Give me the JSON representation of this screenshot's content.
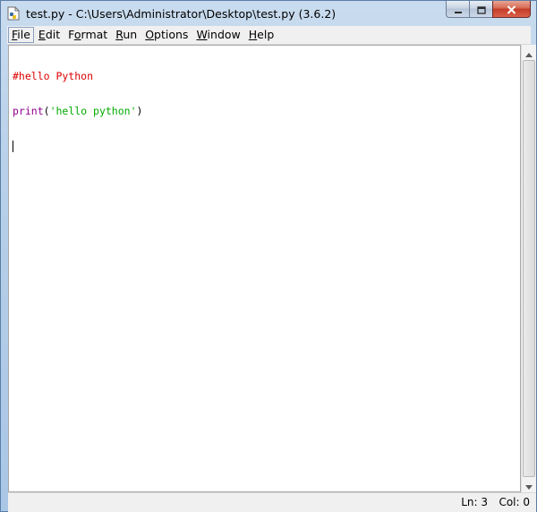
{
  "window": {
    "title": "test.py - C:\\Users\\Administrator\\Desktop\\test.py (3.6.2)",
    "icon": "python-file-icon"
  },
  "caption_buttons": {
    "minimize_icon": "minimize-icon",
    "maximize_icon": "maximize-icon",
    "close_icon": "close-icon"
  },
  "menu": {
    "items": [
      {
        "label_rest": "ile",
        "mnemonic": "F"
      },
      {
        "label_rest": "dit",
        "mnemonic": "E"
      },
      {
        "label_pre": "F",
        "mnemonic": "o",
        "label_rest": "rmat"
      },
      {
        "label_rest": "un",
        "mnemonic": "R"
      },
      {
        "label_rest": "ptions",
        "mnemonic": "O"
      },
      {
        "label_rest": "indow",
        "mnemonic": "W"
      },
      {
        "label_rest": "elp",
        "mnemonic": "H"
      }
    ]
  },
  "editor": {
    "lines": [
      {
        "comment": "#hello Python"
      },
      {
        "builtin": "print",
        "open": "(",
        "string": "'hello python'",
        "close": ")"
      }
    ]
  },
  "status": {
    "line": "Ln: 3",
    "col": "Col: 0"
  },
  "colors": {
    "comment": "#dd0000",
    "builtin": "#900090",
    "string": "#00aa00",
    "titlebar": "#b9d1ea"
  }
}
